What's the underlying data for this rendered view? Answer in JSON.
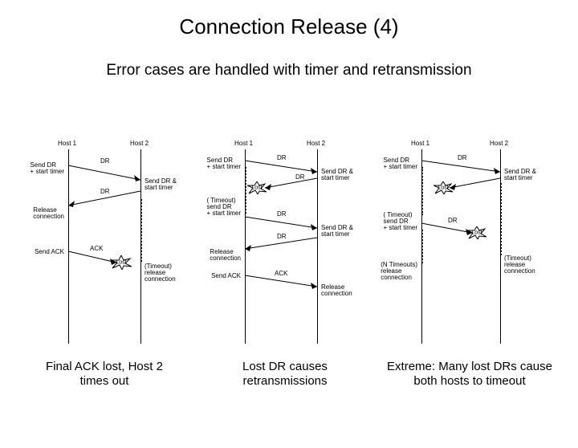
{
  "title": "Connection Release (4)",
  "subtitle": "Error cases are handled with timer and retransmission",
  "labels": {
    "host1": "Host 1",
    "host2": "Host 2",
    "dr": "DR",
    "ack": "ACK",
    "lost": "Lost"
  },
  "panel1": {
    "h1_e1": "Send DR\n+ start timer",
    "h1_e2": "Release\nconnection",
    "h1_e3": "Send ACK",
    "h2_e1": "Send DR &\nstart timer",
    "h2_e2": "(Timeout)\nrelease\nconnection"
  },
  "panel2": {
    "h1_e1": "Send DR\n+ start timer",
    "h1_e2": "( Timeout)\nsend DR\n+ start timer",
    "h1_e3": "Release\nconnection",
    "h1_e4": "Send ACK",
    "h2_e1": "Send DR &\nstart timer",
    "h2_e2": "Send DR &\nstart timer",
    "h2_e3": "Release\nconnection"
  },
  "panel3": {
    "h1_e1": "Send DR\n+ start timer",
    "h1_e2": "( Timeout)\nsend DR\n+ start timer",
    "h1_e3": "(N Timeouts)\nrelease\nconnection",
    "h2_e1": "Send DR &\nstart timer",
    "h2_e2": "(Timeout)\nrelease\nconnection"
  },
  "captions": {
    "c1": "Final ACK lost,\nHost 2 times out",
    "c2": "Lost DR causes\nretransmissions",
    "c3": "Extreme: Many lost\nDRs cause both\nhosts to timeout"
  }
}
